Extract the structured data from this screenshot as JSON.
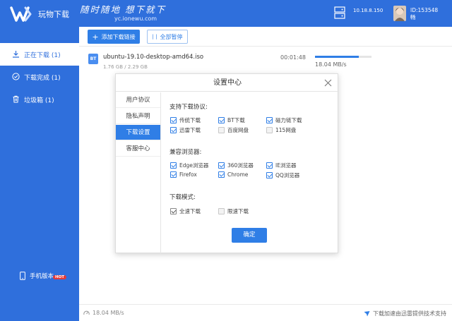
{
  "header": {
    "app_title": "玩物下载",
    "slogan": "随时随地 想下就下",
    "site_url": "yc.ionewu.com",
    "ip": "10.18.8.150",
    "user_id": "ID:153548",
    "user_name": "畅",
    "brand_color": "#2f6fdc"
  },
  "sidebar": {
    "items": [
      {
        "label": "正在下载 (1)",
        "icon": "download-icon",
        "active": true
      },
      {
        "label": "下载完成 (1)",
        "icon": "check-circle-icon",
        "active": false
      },
      {
        "label": "垃圾箱 (1)",
        "icon": "trash-icon",
        "active": false
      }
    ],
    "mobile_label": "手机版本",
    "hot_badge": "HOT"
  },
  "toolbar": {
    "add_label": "添加下载链接",
    "pause_label": "全部暂停"
  },
  "downloads": [
    {
      "type": "BT",
      "name": "ubuntu-19.10-desktop-amd64.iso",
      "size": "1.76 GB / 2.29 GB",
      "eta": "00:01:48",
      "speed": "18.04 MB/s",
      "progress": 0.77
    }
  ],
  "statusbar": {
    "speed": "18.04 MB/s",
    "accel_text": "下载加速由迅雷提供技术支持"
  },
  "dialog": {
    "title": "设置中心",
    "nav": [
      {
        "label": "用户协议",
        "active": false
      },
      {
        "label": "隐私声明",
        "active": false
      },
      {
        "label": "下载设置",
        "active": true
      },
      {
        "label": "客服中心",
        "active": false
      }
    ],
    "protocols_title": "支持下载协议:",
    "protocols": [
      {
        "label": "传统下载",
        "checked": true
      },
      {
        "label": "BT下载",
        "checked": true
      },
      {
        "label": "磁力链下载",
        "checked": true
      },
      {
        "label": "迅雷下载",
        "checked": true
      },
      {
        "label": "百度网盘",
        "checked": false
      },
      {
        "label": "115网盘",
        "checked": false
      }
    ],
    "browsers_title": "兼容浏览器:",
    "browsers": [
      {
        "label": "Edge浏览器",
        "checked": true
      },
      {
        "label": "360浏览器",
        "checked": true
      },
      {
        "label": "IE浏览器",
        "checked": true
      },
      {
        "label": "Firefox",
        "checked": true
      },
      {
        "label": "Chrome",
        "checked": true
      },
      {
        "label": "QQ浏览器",
        "checked": true
      }
    ],
    "mode_title": "下载模式:",
    "modes": [
      {
        "label": "全速下载",
        "checked": true
      },
      {
        "label": "限速下载",
        "checked": false
      }
    ],
    "ok_label": "确定"
  }
}
